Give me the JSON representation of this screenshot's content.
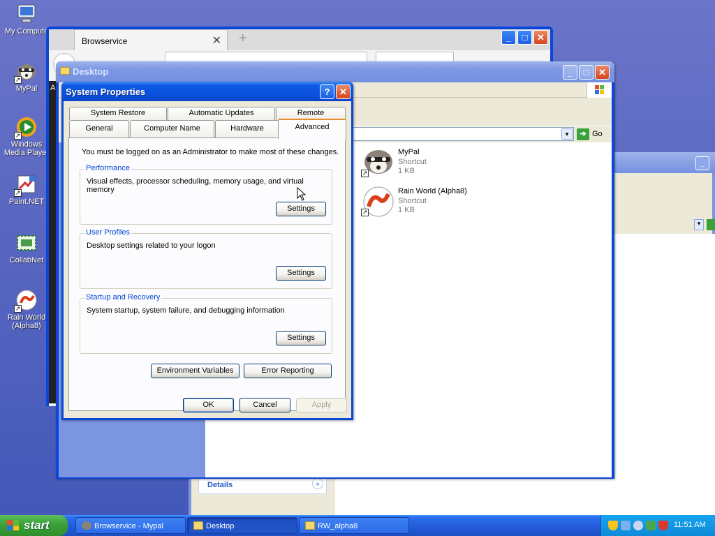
{
  "desktop_icons": [
    {
      "label": "My Compute",
      "icon": "my-computer-icon"
    },
    {
      "label": "MyPal",
      "icon": "raccoon-icon"
    },
    {
      "label": "Windows Media Player",
      "icon": "media-player-icon"
    },
    {
      "label": "Paint.NET",
      "icon": "paint-icon"
    },
    {
      "label": "CollabNet",
      "icon": "collabnet-icon"
    },
    {
      "label": "Rain World (Alpha8)",
      "icon": "rain-world-icon"
    }
  ],
  "browser": {
    "tab_title": "Browservice",
    "close_tab": "✕",
    "new_tab": "+",
    "sidebar_letter": "A"
  },
  "explorer": {
    "title": "Desktop",
    "go_label": "Go",
    "files": [
      {
        "name": "MyPal",
        "type": "Shortcut",
        "size": "1 KB"
      },
      {
        "name": "Rain World (Alpha8)",
        "type": "Shortcut",
        "size": "1 KB"
      }
    ]
  },
  "background_window": {
    "details_label": "Details"
  },
  "dialog": {
    "title": "System Properties",
    "help": "?",
    "close": "✕",
    "tabs_row1": [
      "System Restore",
      "Automatic Updates",
      "Remote"
    ],
    "tabs_row2": [
      "General",
      "Computer Name",
      "Hardware",
      "Advanced"
    ],
    "notice": "You must be logged on as an Administrator to make most of these changes.",
    "groups": [
      {
        "title": "Performance",
        "desc": "Visual effects, processor scheduling, memory usage, and virtual memory",
        "button": "Settings"
      },
      {
        "title": "User Profiles",
        "desc": "Desktop settings related to your logon",
        "button": "Settings"
      },
      {
        "title": "Startup and Recovery",
        "desc": "System startup, system failure, and debugging information",
        "button": "Settings"
      }
    ],
    "env_button": "Environment Variables",
    "error_button": "Error Reporting",
    "ok": "OK",
    "cancel": "Cancel",
    "apply": "Apply"
  },
  "taskbar": {
    "start": "start",
    "items": [
      "Browservice - Mypal",
      "Desktop",
      "RW_alpha8"
    ],
    "clock": "11:51 AM"
  },
  "colors": {
    "xp_blue": "#0a46d8",
    "group_title": "#0046d5",
    "active_tab_accent": "#e68b2c",
    "start_green": "#3ca23a"
  }
}
